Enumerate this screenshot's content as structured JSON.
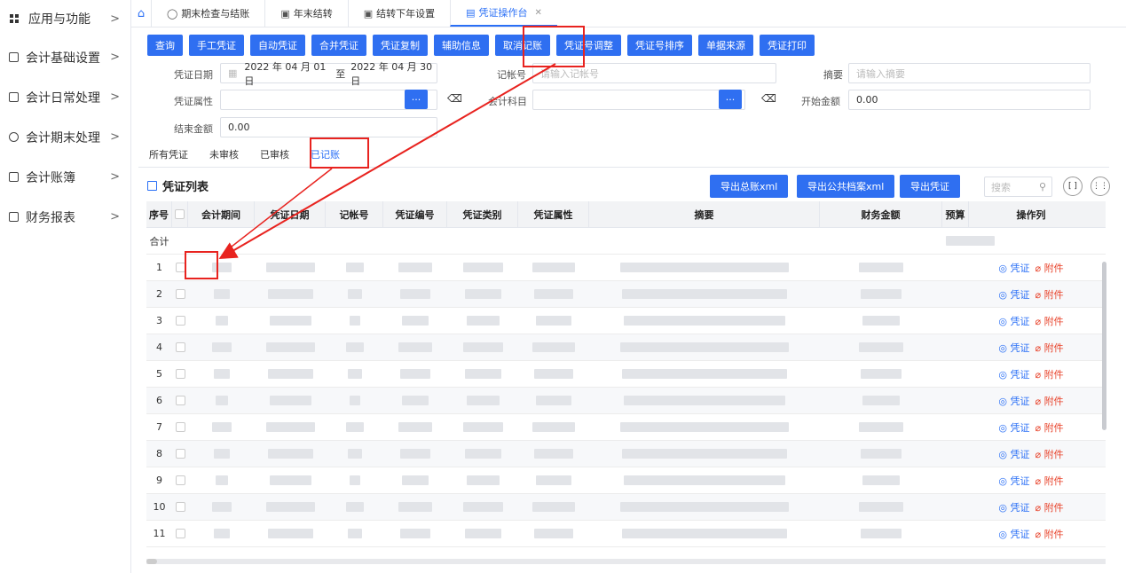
{
  "sidebar": {
    "items": [
      {
        "label": "应用与功能",
        "icon": "grid-icon"
      },
      {
        "label": "会计基础设置",
        "icon": "settings-doc-icon"
      },
      {
        "label": "会计日常处理",
        "icon": "card-icon"
      },
      {
        "label": "会计期末处理",
        "icon": "clock-icon"
      },
      {
        "label": "会计账簿",
        "icon": "book-icon"
      },
      {
        "label": "财务报表",
        "icon": "report-icon"
      }
    ],
    "chevron": ">"
  },
  "tabs": [
    {
      "label": "期末检查与结账"
    },
    {
      "label": "年末结转"
    },
    {
      "label": "结转下年设置"
    },
    {
      "label": "凭证操作台",
      "active": true
    }
  ],
  "toolbar": [
    "查询",
    "手工凭证",
    "自动凭证",
    "合并凭证",
    "凭证复制",
    "辅助信息",
    "取消记账",
    "凭证号调整",
    "凭证号排序",
    "单据来源",
    "凭证打印"
  ],
  "form": {
    "date_label": "凭证日期",
    "date_start": "2022 年 04 月 01 日",
    "date_sep": "至",
    "date_end": "2022 年 04 月 30 日",
    "acct_no_label": "记帐号",
    "acct_no_placeholder": "请输入记帐号",
    "summary_label": "摘要",
    "summary_placeholder": "请输入摘要",
    "attr_label": "凭证属性",
    "subject_label": "会计科目",
    "start_amount_label": "开始金额",
    "start_amount": "0.00",
    "end_amount_label": "结束金额",
    "end_amount": "0.00",
    "dots": "···"
  },
  "subtabs": [
    {
      "label": "所有凭证"
    },
    {
      "label": "未审核"
    },
    {
      "label": "已审核"
    },
    {
      "label": "已记账",
      "active": true
    }
  ],
  "list": {
    "title": "凭证列表",
    "export_buttons": [
      "导出总账xml",
      "导出公共档案xml",
      "导出凭证"
    ],
    "search_placeholder": "搜索"
  },
  "table": {
    "headers": [
      "序号",
      "",
      "会计期间",
      "凭证日期",
      "记帐号",
      "凭证编号",
      "凭证类别",
      "凭证属性",
      "摘要",
      "财务金额",
      "预算",
      "操作列"
    ],
    "total_label": "合计",
    "rows": [
      "1",
      "2",
      "3",
      "4",
      "5",
      "6",
      "7",
      "8",
      "9",
      "10",
      "11"
    ],
    "op_view": "凭证",
    "op_attach": "附件"
  },
  "colors": {
    "accent": "#2f6ff1",
    "highlight": "#e8231f",
    "attach": "#e8432b"
  }
}
